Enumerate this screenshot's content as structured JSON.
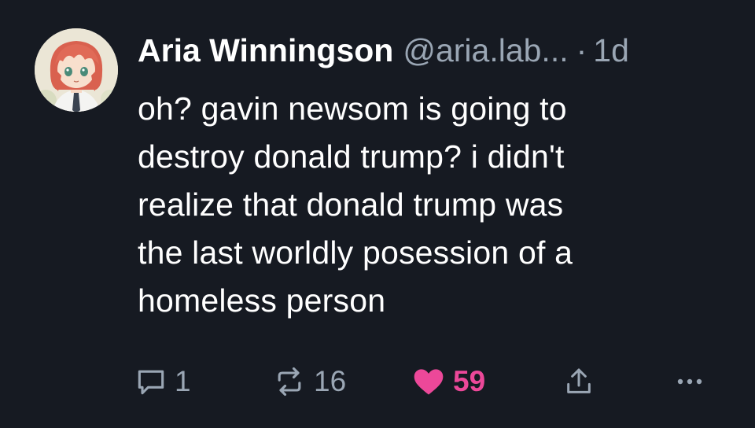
{
  "post": {
    "author": {
      "display_name": "Aria Winningson",
      "handle": "@aria.lab...",
      "avatar_icon": "anime-avatar"
    },
    "separator": "·",
    "timestamp": "1d",
    "text": "oh? gavin newsom is going to\ndestroy donald trump? i didn't\nrealize that donald trump was\nthe last worldly posession of a\nhomeless person",
    "actions": {
      "reply": {
        "icon": "reply-icon",
        "count": "1"
      },
      "repost": {
        "icon": "repost-icon",
        "count": "16"
      },
      "like": {
        "icon": "heart-icon",
        "count": "59",
        "liked": true,
        "color": "#ec4899"
      },
      "share": {
        "icon": "share-icon"
      },
      "more": {
        "icon": "more-icon"
      }
    }
  },
  "theme": {
    "background": "#161a22",
    "text": "#ffffff",
    "muted": "#9aa6b4"
  }
}
